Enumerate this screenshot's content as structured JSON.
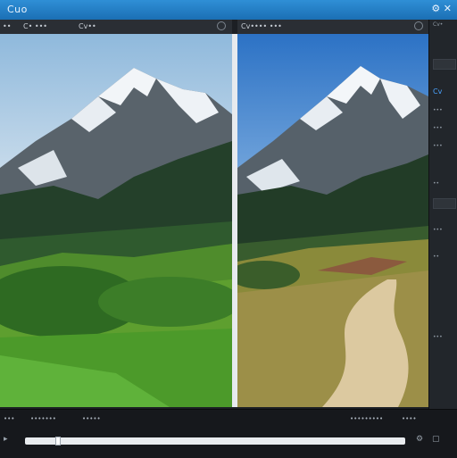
{
  "app": {
    "title": "Cuo",
    "window_icons": "⚙ ✕"
  },
  "left_panel": {
    "label_1": "••",
    "label_2": "C• •••",
    "label_3": "Cv••",
    "control_icon": "refresh-icon"
  },
  "right_panel": {
    "label_1": "Cv•••• •••",
    "control_icon": "refresh-icon"
  },
  "side_column": {
    "top_label": "Cv•",
    "accent_label": "Cv",
    "items": [
      "•••",
      "•••",
      "•••",
      "••",
      "•••",
      "••",
      "•••"
    ]
  },
  "bottom_bar": {
    "labels": [
      "•••",
      "•••••••",
      "•••••",
      "•••••••••",
      "••••"
    ],
    "slider_value": 0.08
  },
  "colors": {
    "title_bar": "#1b6fb4",
    "accent": "#4aa3ff"
  }
}
